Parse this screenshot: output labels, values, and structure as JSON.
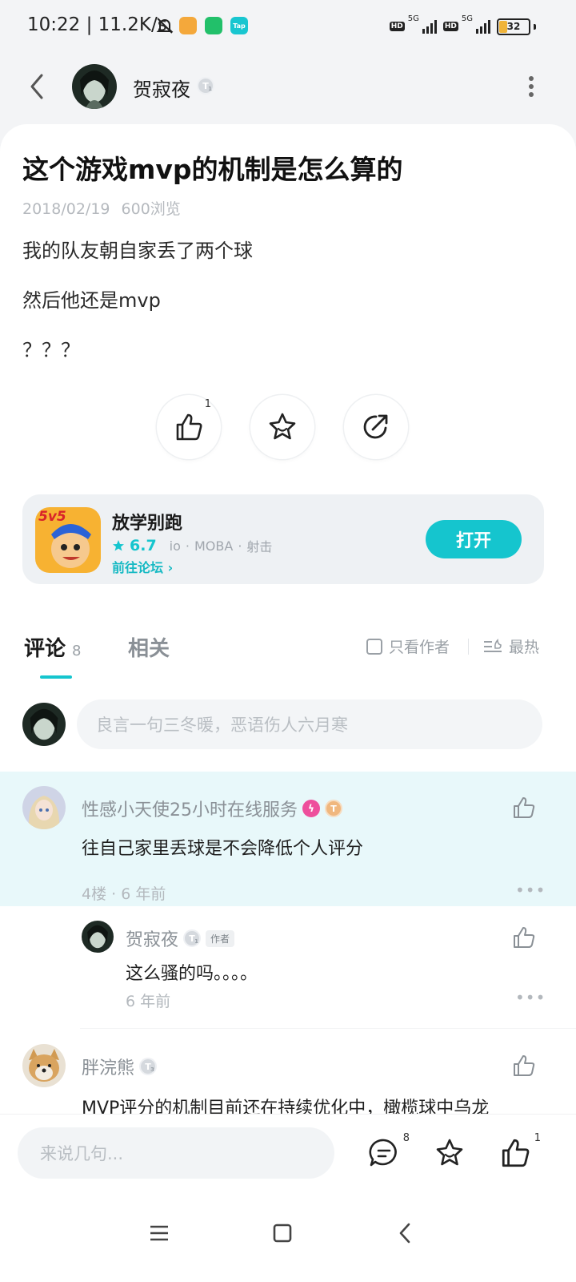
{
  "status_bar": {
    "time_speed": "10:22 | 11.2K/s",
    "battery": "32",
    "network": "5G",
    "hd": "HD",
    "tap_label": "Tap"
  },
  "header": {
    "author_name": "贺寂夜",
    "level": "T",
    "level_num": "1"
  },
  "post": {
    "title": "这个游戏mvp的机制是怎么算的",
    "date": "2018/02/19",
    "views": "600浏览",
    "lines": [
      "我的队友朝自家丢了两个球",
      "然后他还是mvp",
      "？？？"
    ],
    "like_count": "1"
  },
  "game": {
    "name": "放学别跑",
    "score": "6.7",
    "tags": [
      "io",
      "MOBA",
      "射击"
    ],
    "forum_link": "前往论坛",
    "open_label": "打开",
    "icon_text": "5v5"
  },
  "comments_section": {
    "tab_comments": "评论",
    "comment_count": "8",
    "tab_related": "相关",
    "author_only": "只看作者",
    "sort": "最热",
    "input_placeholder": "良言一句三冬暖，恶语伤人六月寒"
  },
  "comments": [
    {
      "user": "性感小天使25小时在线服务",
      "badge_level": "T",
      "badge_num": "6",
      "text": "往自己家里丢球是不会降低个人评分",
      "meta": "4楼 · 6 年前"
    },
    {
      "user": "胖浣熊",
      "badge_level": "T",
      "badge_num": "3",
      "text": "MVP评分的机制目前还在持续优化中，橄榄球中乌龙"
    }
  ],
  "reply": {
    "user": "贺寂夜",
    "badge_level": "T",
    "badge_num": "1",
    "author_tag": "作者",
    "text": "这么骚的吗。。。。",
    "meta": "6 年前"
  },
  "bottom_bar": {
    "placeholder": "来说几句...",
    "comment_count": "8",
    "like_count": "1"
  },
  "colors": {
    "accent": "#15c5ce",
    "highlight_bg": "#e8f8fa"
  }
}
